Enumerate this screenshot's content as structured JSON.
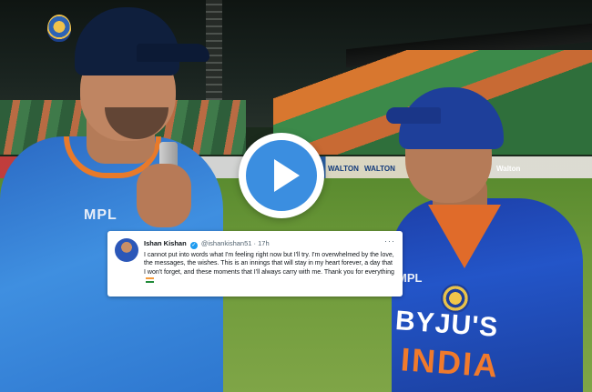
{
  "video": {
    "play_icon": "play-icon",
    "colors": {
      "play_blue": "#3b8ee0",
      "jersey_blue": "#2355c8",
      "accent_orange": "#e87a2a"
    }
  },
  "stadium": {
    "boards": [
      "WALTON",
      "WALTON",
      "Walton"
    ]
  },
  "players": {
    "left": {
      "jersey_text": "MPL"
    },
    "right": {
      "jersey_sponsor": "MPL",
      "jersey_text": "BYJU'S",
      "jersey_team": "INDIA"
    }
  },
  "tweet": {
    "name": "Ishan Kishan",
    "handle": "@ishankishan51",
    "separator": "·",
    "time": "17h",
    "more_icon": "···",
    "text": "I cannot put into words what I'm feeling right now but I'll try. I'm overwhelmed by the love, the messages, the wishes. This is an innings that will stay in my heart forever, a day that I won't forget, and these moments that I'll always carry with me. Thank you for everything"
  }
}
